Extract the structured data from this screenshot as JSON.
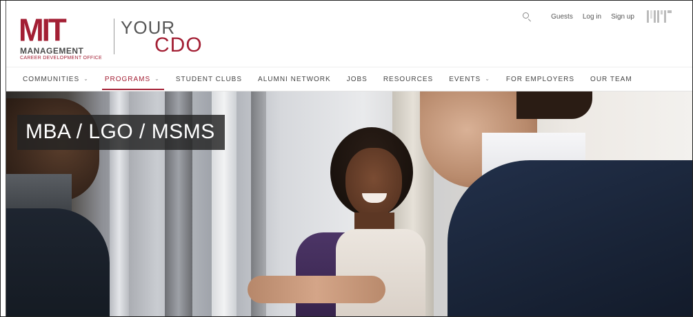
{
  "logo": {
    "mit": "MIT",
    "management": "MANAGEMENT",
    "subtitle": "CAREER DEVELOPMENT OFFICE",
    "your": "YOUR",
    "cdo": "CDO"
  },
  "utility": {
    "search_icon": "search-icon",
    "guests": "Guests",
    "login": "Log in",
    "signup": "Sign up",
    "mit_mark": "mit-logo-icon"
  },
  "nav": {
    "items": [
      {
        "label": "COMMUNITIES",
        "dropdown": true
      },
      {
        "label": "PROGRAMS",
        "dropdown": true
      },
      {
        "label": "STUDENT CLUBS"
      },
      {
        "label": "ALUMNI NETWORK"
      },
      {
        "label": "JOBS"
      },
      {
        "label": "RESOURCES"
      },
      {
        "label": "EVENTS",
        "dropdown": true
      },
      {
        "label": "FOR EMPLOYERS"
      },
      {
        "label": "OUR TEAM"
      }
    ],
    "active": "PROGRAMS",
    "chevron": "⌄"
  },
  "hero": {
    "title": "MBA / LGO / MSMS"
  },
  "colors": {
    "brand": "#a31f34",
    "text": "#444444",
    "title_bg": "#232323"
  }
}
